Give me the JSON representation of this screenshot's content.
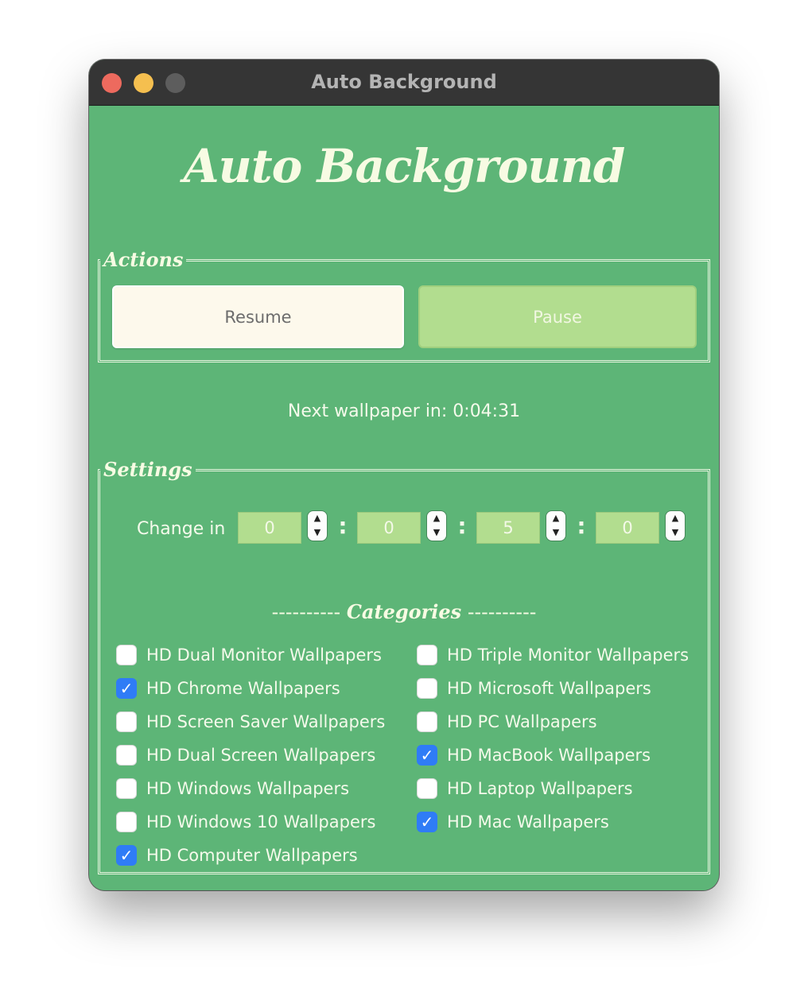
{
  "window": {
    "title": "Auto Background"
  },
  "app": {
    "heading": "Auto Background"
  },
  "actions": {
    "legend": "Actions",
    "resume_label": "Resume",
    "pause_label": "Pause"
  },
  "status": {
    "countdown": "Next wallpaper in: 0:04:31"
  },
  "settings": {
    "legend": "Settings",
    "change_in_label": "Change in",
    "fields": [
      "0",
      "0",
      "5",
      "0"
    ],
    "separator": ":"
  },
  "categories": {
    "dashes_left": "----------",
    "heading": "Categories",
    "dashes_right": "----------",
    "left": [
      {
        "label": "HD Dual Monitor Wallpapers",
        "checked": false
      },
      {
        "label": "HD Chrome Wallpapers",
        "checked": true
      },
      {
        "label": "HD Screen Saver Wallpapers",
        "checked": false
      },
      {
        "label": "HD Dual Screen Wallpapers",
        "checked": false
      },
      {
        "label": "HD Windows Wallpapers",
        "checked": false
      },
      {
        "label": "HD Windows 10 Wallpapers",
        "checked": false
      },
      {
        "label": "HD Computer Wallpapers",
        "checked": true
      }
    ],
    "right": [
      {
        "label": "HD Triple Monitor Wallpapers",
        "checked": false
      },
      {
        "label": "HD Microsoft Wallpapers",
        "checked": false
      },
      {
        "label": "HD PC Wallpapers",
        "checked": false
      },
      {
        "label": "HD MacBook Wallpapers",
        "checked": true
      },
      {
        "label": "HD Laptop Wallpapers",
        "checked": false
      },
      {
        "label": "HD Mac Wallpapers",
        "checked": true
      }
    ]
  },
  "colors": {
    "window_bg": "#5db577",
    "titlebar_bg": "#353535",
    "pause_bg": "#b2dd8f",
    "resume_bg": "#fdf9ec",
    "checkbox_checked": "#2f7cf6"
  }
}
